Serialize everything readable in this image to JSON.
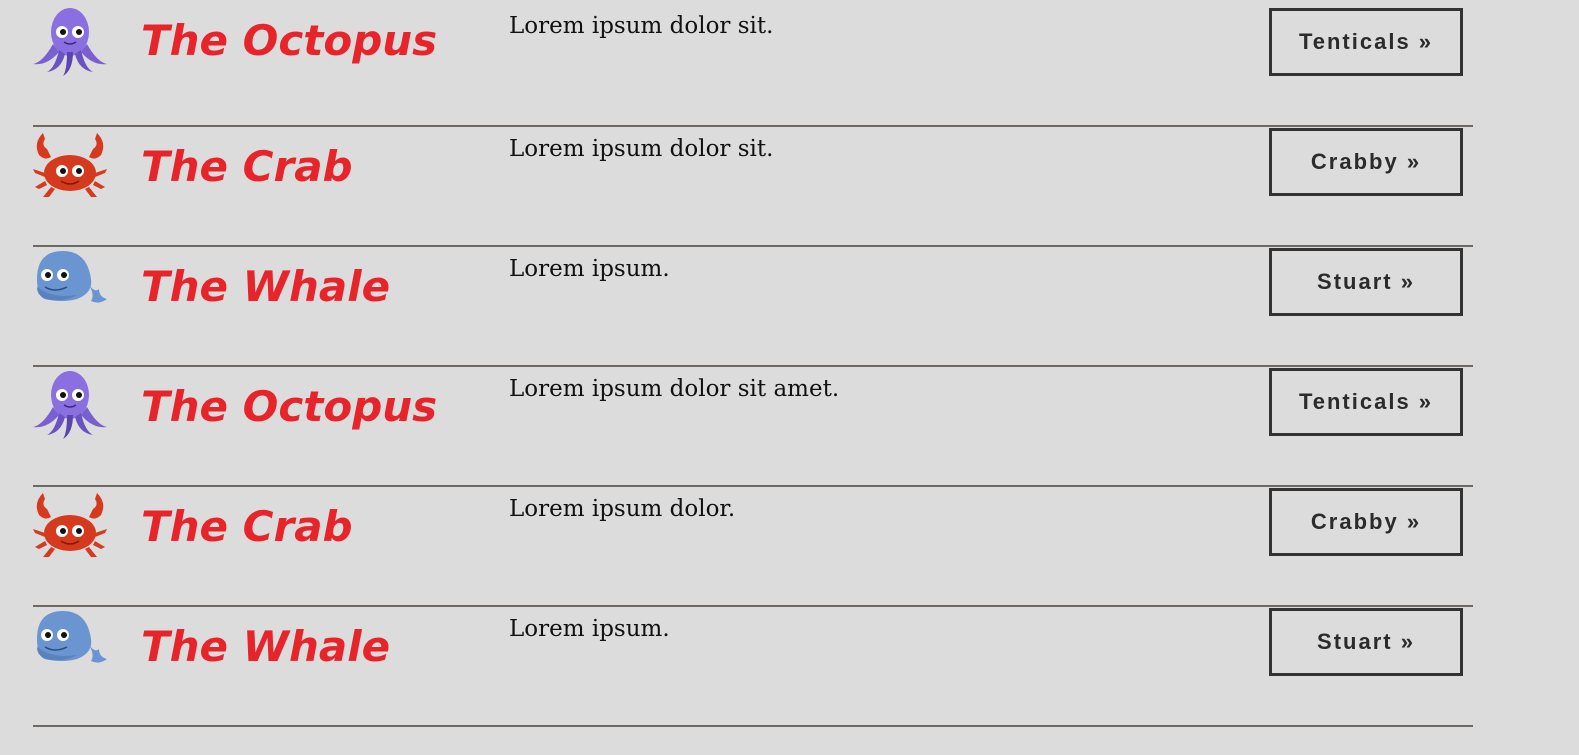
{
  "colors": {
    "background": "#dcdcdc",
    "title": "#e8242b",
    "divider": "#6e6a63",
    "button_border": "#333333",
    "octopus": "#8a6fe0",
    "crab": "#d63a1e",
    "whale": "#6a95d1"
  },
  "items": [
    {
      "icon": "octopus-icon",
      "title": "The Octopus",
      "description": "Lorem ipsum dolor sit.",
      "button_label": "Tenticals »"
    },
    {
      "icon": "crab-icon",
      "title": "The Crab",
      "description": "Lorem ipsum dolor sit.",
      "button_label": "Crabby »"
    },
    {
      "icon": "whale-icon",
      "title": "The Whale",
      "description": "Lorem ipsum.",
      "button_label": "Stuart »"
    },
    {
      "icon": "octopus-icon",
      "title": "The Octopus",
      "description": "Lorem ipsum dolor sit amet.",
      "button_label": "Tenticals »"
    },
    {
      "icon": "crab-icon",
      "title": "The Crab",
      "description": "Lorem ipsum dolor.",
      "button_label": "Crabby »"
    },
    {
      "icon": "whale-icon",
      "title": "The Whale",
      "description": "Lorem ipsum.",
      "button_label": "Stuart »"
    }
  ]
}
